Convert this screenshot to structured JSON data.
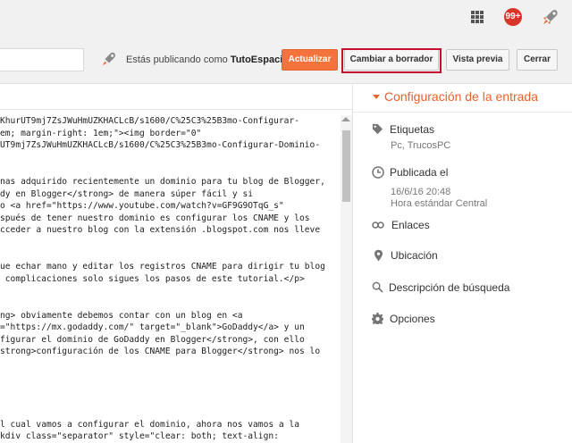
{
  "topbar": {
    "notifications_count": "99+"
  },
  "toolbar": {
    "publishing_prefix": "Estás publicando como",
    "publishing_name": "TutoEspacio",
    "update_label": "Actualizar",
    "revert_label": "Cambiar a borrador",
    "preview_label": "Vista previa",
    "close_label": "Cerrar"
  },
  "editor": {
    "lines": [
      "KhurUT9mj7ZsJWuHmUZKHACLcB/s1600/C%25C3%25B3mo-Configurar-",
      "em; margin-right: 1em;\"><img border=\"0\"",
      "UT9mj7ZsJWuHmUZKHACLcB/s1600/C%25C3%25B3mo-Configurar-Dominio-",
      "",
      "",
      "nas adquirido recientemente un dominio para tu blog de Blogger,",
      "dy en Blogger</strong> de manera súper fácil y si",
      "o <a href=\"https://www.youtube.com/watch?v=GF9G9OTqG_s\"",
      "spués de tener nuestro dominio es configurar los CNAME y los",
      "cceder a nuestro blog con la extensión .blogspot.com nos lleve",
      "",
      "",
      "ue echar mano y editar los registros CNAME para dirigir tu blog",
      " complicaciones solo sigues los pasos de este tutorial.</p>",
      "",
      "",
      "ng> obviamente debemos contar con un blog en <a",
      "=\"https://mx.godaddy.com/\" target=\"_blank\">GoDaddy</a> y un",
      "figurar el dominio de GoDaddy en Blogger</strong>, con ello",
      "strong>configuración de los CNAME para Blogger</strong> nos lo",
      "",
      "",
      "",
      "",
      "",
      "l cual vamos a configurar el dominio, ahora nos vamos a la",
      "kdiv class=\"separator\" style=\"clear: both; text-align:"
    ]
  },
  "sidebar": {
    "title": "Configuración de la entrada",
    "labels_title": "Etiquetas",
    "labels_value": "Pc, TrucosPC",
    "published_title": "Publicada el",
    "published_date": "16/6/16 20:48",
    "published_tz": "Hora estándar Central",
    "links_title": "Enlaces",
    "location_title": "Ubicación",
    "search_desc_title": "Descripción de búsqueda",
    "options_title": "Opciones"
  },
  "colors": {
    "accent": "#e8622b",
    "update_button": "#f4733c",
    "highlight_box": "#c8102e",
    "badge": "#d9352a"
  },
  "icons": [
    "apps-grid-icon",
    "blogger-rocket-icon",
    "tag-icon",
    "clock-icon",
    "link-icon",
    "location-pin-icon",
    "search-icon",
    "gear-icon"
  ]
}
